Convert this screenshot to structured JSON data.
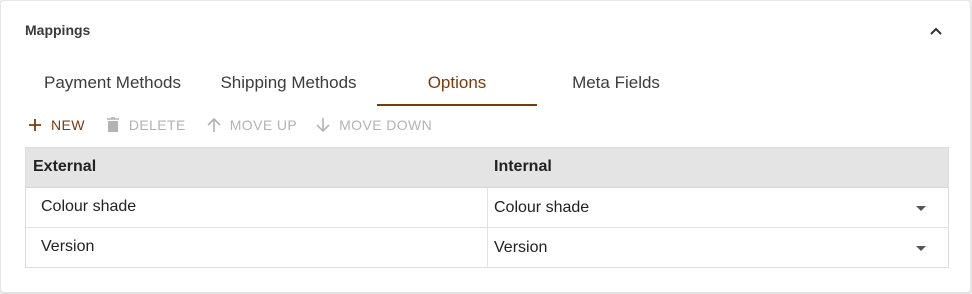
{
  "panel": {
    "title": "Mappings",
    "collapse_icon": "chevron-up-icon"
  },
  "tabs": [
    {
      "label": "Payment Methods",
      "active": false
    },
    {
      "label": "Shipping Methods",
      "active": false
    },
    {
      "label": "Options",
      "active": true
    },
    {
      "label": "Meta Fields",
      "active": false
    }
  ],
  "toolbar": {
    "new_label": "NEW",
    "delete_label": "DELETE",
    "move_up_label": "MOVE UP",
    "move_down_label": "MOVE DOWN"
  },
  "table": {
    "headers": {
      "external": "External",
      "internal": "Internal"
    },
    "rows": [
      {
        "external": "Colour shade",
        "internal": "Colour shade"
      },
      {
        "external": "Version",
        "internal": "Version"
      }
    ]
  },
  "colors": {
    "accent": "#7a3b0c",
    "disabled": "#b3b3b3",
    "header_bg": "#e4e4e4"
  }
}
